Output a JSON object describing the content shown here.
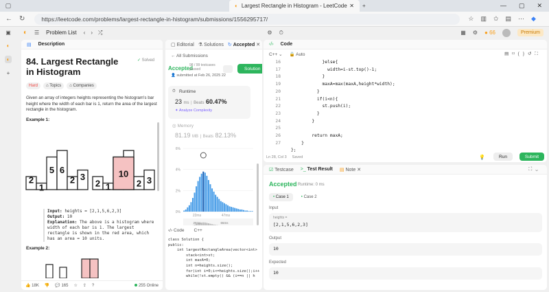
{
  "browser": {
    "tab_title": "Largest Rectangle in Histogram - LeetCode",
    "url": "https://leetcode.com/problems/largest-rectangle-in-histogram/submissions/1556295717/"
  },
  "lc": {
    "problem_list": "Problem List",
    "coins": "66",
    "premium": "Premium"
  },
  "description": {
    "tab": "Description",
    "title": "84. Largest Rectangle in Histogram",
    "solved": "Solved",
    "tags": [
      "Hard",
      "Topics",
      "Companies"
    ],
    "text": "Given an array of integers heights representing the histogram's bar height where the width of each bar is 1, return the area of the largest rectangle in the histogram.",
    "example1": "Example 1:",
    "input": "heights = [2,1,5,6,2,3]",
    "output": "10",
    "explanation": "The above is a histogram where width of each bar is 1. The largest rectangle is shown in the red area, which has an area = 10 units.",
    "example2": "Example 2:",
    "hist1_vals": [
      2,
      1,
      5,
      6,
      2,
      3
    ],
    "hist2_vals": [
      2,
      1,
      10,
      2,
      3
    ],
    "likes": "18K",
    "comments": "165",
    "online": "255 Online"
  },
  "submission": {
    "tabs": [
      "Editorial",
      "Solutions",
      "Accepted"
    ],
    "back": "All Submissions",
    "status": "Accepted",
    "passed": "98 / 99 testcases passed",
    "submitted": "submitted at Feb 26, 2025 22",
    "solution_btn": "Solution",
    "runtime_label": "Runtime",
    "runtime_value": "23",
    "runtime_unit": "ms",
    "beats_label": "Beats",
    "runtime_beats": "60.47%",
    "analyze": "Analyze Complexity",
    "memory_label": "Memory",
    "memory_value": "81.19",
    "memory_unit": "MB",
    "memory_beats": "82.13%",
    "code_tab": "Code",
    "lang": "C++",
    "code": [
      "class Solution {",
      "public:",
      "    int largestRectangleArea(vector<int>",
      "        stack<int>st;",
      "        int maxA=0;",
      "        int n=heights.size();",
      "        for(int i=0;i<=heights.size();i++",
      "        while(!st.empty() && (i==n || h"
    ]
  },
  "chart_data": {
    "type": "bar",
    "ylabels": [
      "6%",
      "4%",
      "2%",
      "0%"
    ],
    "xlabels": [
      "22ms",
      "47ms"
    ],
    "ylim": [
      0,
      6
    ],
    "values": [
      0.1,
      0.2,
      0.4,
      0.6,
      0.9,
      1.3,
      1.8,
      2.4,
      2.9,
      3.3,
      3.6,
      3.8,
      3.7,
      3.4,
      3.0,
      2.6,
      2.2,
      1.9,
      1.6,
      1.4,
      1.2,
      1.0,
      0.9,
      0.8,
      0.7,
      0.6,
      0.5,
      0.45,
      0.4,
      0.35,
      0.3,
      0.25,
      0.2,
      0.2,
      0.15,
      0.1,
      0.1,
      0.05,
      0.05,
      0.05
    ],
    "mini_xlabels": [
      "25ms",
      "65ms"
    ]
  },
  "editor": {
    "title": "Code",
    "lang": "C++",
    "mode": "Auto",
    "line_nums": [
      "16",
      "17",
      "18",
      "19",
      "20",
      "21",
      "22",
      "23",
      "24",
      "25",
      "26",
      "27"
    ],
    "lines": [
      "            }else{",
      "              width=i-st.top()-1;",
      "            }",
      "            maxA=max(maxA,height*width);",
      "          }",
      "          if(i<n){",
      "            st.push(i);",
      "          }",
      "        }",
      "",
      "        return maxA;",
      "    }",
      "};"
    ],
    "status": "Ln 28, Col 3",
    "saved": "Saved",
    "run": "Run",
    "submit": "Submit"
  },
  "test": {
    "tabs": [
      "Testcase",
      "Test Result",
      "Note"
    ],
    "status": "Accepted",
    "runtime": "Runtime: 0 ms",
    "cases": [
      "Case 1",
      "Case 2"
    ],
    "input_label": "Input",
    "input_var": "heights =",
    "input_val": "[2,1,5,6,2,3]",
    "output_label": "Output",
    "output_val": "10",
    "expected_label": "Expected",
    "expected_val": "10"
  }
}
